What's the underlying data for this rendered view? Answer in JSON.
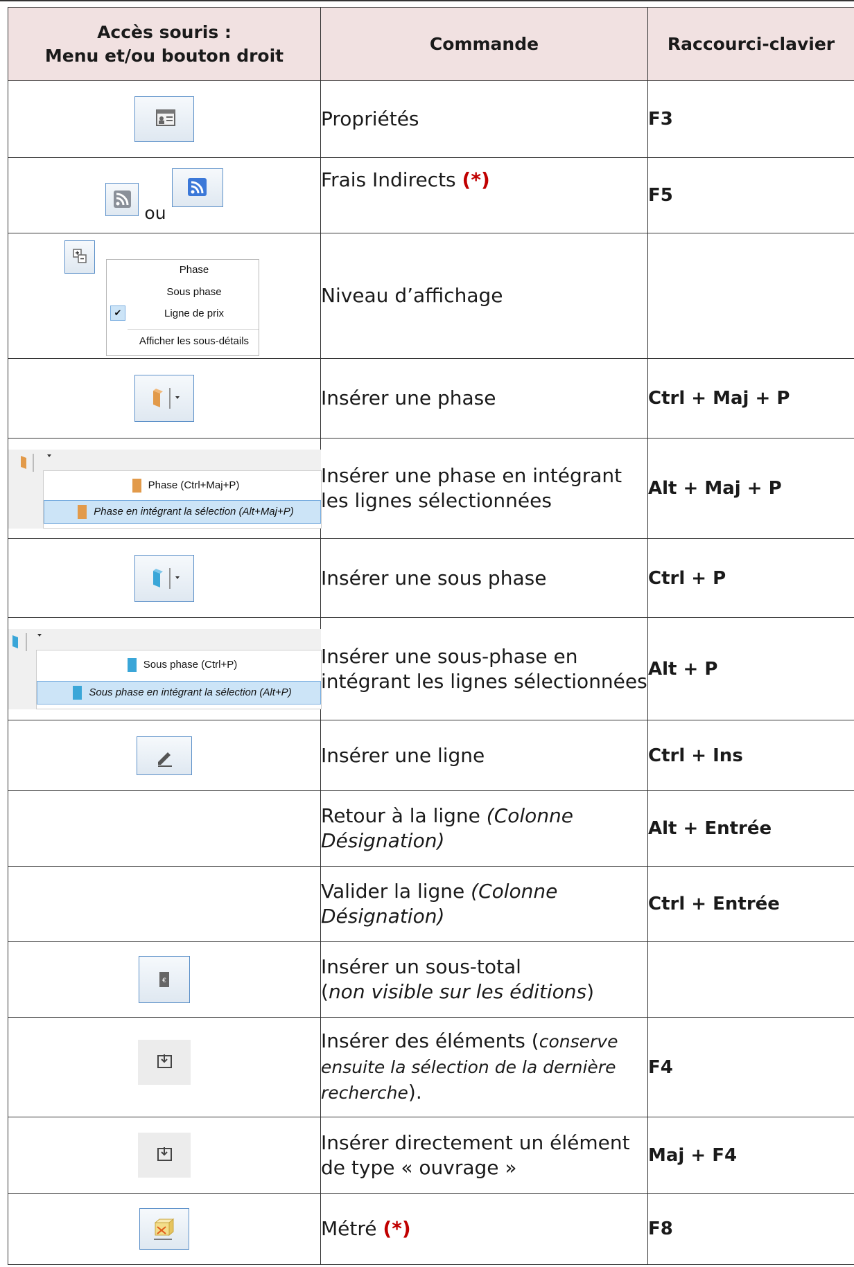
{
  "headers": {
    "col1_line1": "Accès souris :",
    "col1_line2": "Menu et/ou bouton droit",
    "col2": "Commande",
    "col3": "Raccourci-clavier"
  },
  "ou_label": "ou",
  "rows": [
    {
      "cmd": "Propriétés",
      "key": "F3",
      "icon": "properties-icon"
    },
    {
      "cmd": "Frais Indirects ",
      "mark": "(*)",
      "key": "F5",
      "icon": "rss-icon"
    },
    {
      "cmd": "Niveau d’affichage",
      "key": "",
      "icon": "display-level-icon",
      "menu": [
        "Phase",
        "Sous phase",
        "Ligne de prix",
        "Afficher les sous-détails"
      ]
    },
    {
      "cmd": "Insérer une phase",
      "key": "Ctrl + Maj + P",
      "icon": "phase-folder-icon"
    },
    {
      "cmd": "Insérer une phase en intégrant les lignes sélectionnées",
      "key": "Alt + Maj + P",
      "menu": [
        "Phase (Ctrl+Maj+P)",
        "Phase en intégrant la sélection (Alt+Maj+P)"
      ]
    },
    {
      "cmd": "Insérer une sous phase",
      "key": "Ctrl + P",
      "icon": "subphase-folder-icon"
    },
    {
      "cmd": "Insérer une sous-phase en intégrant les lignes sélectionnées",
      "key": "Alt + P",
      "menu": [
        "Sous phase (Ctrl+P)",
        "Sous phase en intégrant la sélection (Alt+P)"
      ]
    },
    {
      "cmd": "Insérer une ligne",
      "key": "Ctrl + Ins",
      "icon": "pencil-icon"
    },
    {
      "cmd": "Retour à la ligne ",
      "note": "(Colonne Désignation)",
      "key": "Alt + Entrée"
    },
    {
      "cmd": "Valider la ligne ",
      "note": "(Colonne Désignation)",
      "key": "Ctrl + Entrée"
    },
    {
      "cmd": "Insérer un sous-total",
      "note_pre": "(",
      "note": "non visible sur les éditions",
      "note_post": ")",
      "key": "",
      "icon": "euro-icon"
    },
    {
      "cmd": "Insérer des éléments (",
      "note": "conserve ensuite la sélection de la dernière recherche",
      "note_post": ").",
      "key": "F4",
      "icon": "insert-tray-icon"
    },
    {
      "cmd": "Insérer directement un élément de type « ouvrage »",
      "key": "Maj + F4",
      "icon": "insert-tray-icon"
    },
    {
      "cmd": "Métré ",
      "mark": "(*)",
      "key": "F8",
      "icon": "metre-icon"
    }
  ]
}
